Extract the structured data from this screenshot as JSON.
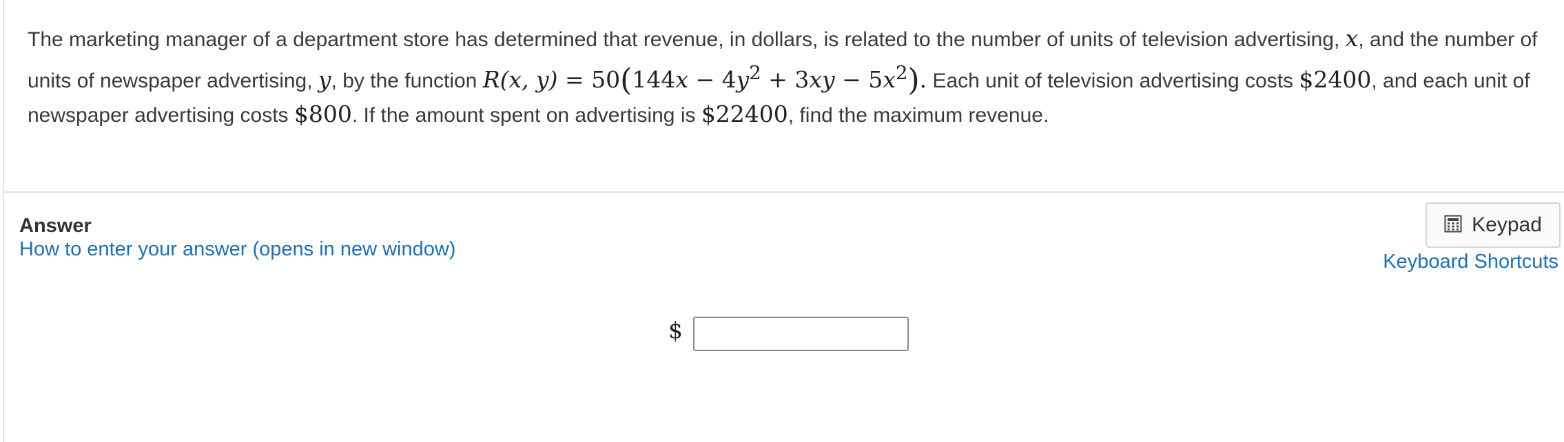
{
  "question": {
    "text_1": "The marketing manager of a department store has determined that revenue, in dollars,  is related to the number of units of television advertising, ",
    "var_x": "x",
    "text_2": ", and the number of units of newspaper advertising, ",
    "var_y": "y",
    "text_3": ", by the function ",
    "func_R": "R",
    "func_args": "(x, y)",
    "func_eq": " = 50",
    "open_paren": "(",
    "term_144x": "144",
    "term_x1": "x",
    "minus_1": " − 4",
    "term_y": "y",
    "exp_2a": "2",
    "plus_1": " + 3",
    "term_xy": "xy",
    "minus_2": " − 5",
    "term_x2": "x",
    "exp_2b": "2",
    "close_paren": ")",
    "period": ".",
    "text_4": " Each unit of television advertising costs ",
    "cost_tv": "$2400",
    "text_5": ", and each unit of newspaper advertising costs ",
    "cost_np": "$800",
    "text_6": ".  If the amount spent on advertising is ",
    "budget": "$22400",
    "text_7": ", find the maximum revenue."
  },
  "answer": {
    "title": "Answer",
    "help_link": "How to enter your answer (opens in new window)",
    "currency_symbol": "$",
    "input_value": ""
  },
  "keypad": {
    "label": "Keypad",
    "icon": "calculator-icon"
  },
  "shortcuts_link": "Keyboard Shortcuts"
}
